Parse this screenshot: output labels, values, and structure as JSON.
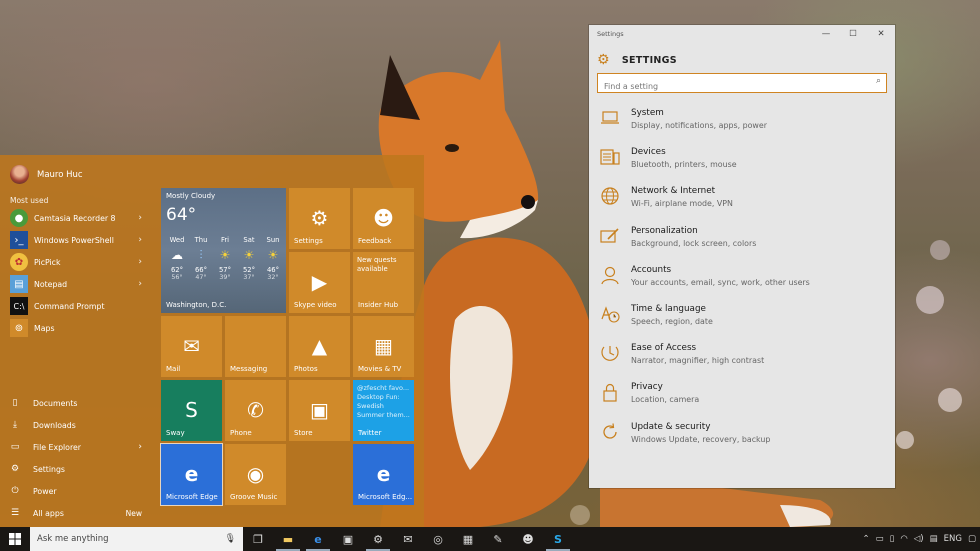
{
  "settings_window": {
    "window_title": "Settings",
    "header": "SETTINGS",
    "search_placeholder": "Find a setting",
    "categories": [
      {
        "name": "System",
        "desc": "Display, notifications, apps, power",
        "icon": "laptop-icon"
      },
      {
        "name": "Devices",
        "desc": "Bluetooth, printers, mouse",
        "icon": "keyboard-icon"
      },
      {
        "name": "Network & Internet",
        "desc": "Wi-Fi, airplane mode, VPN",
        "icon": "globe-icon"
      },
      {
        "name": "Personalization",
        "desc": "Background, lock screen, colors",
        "icon": "paint-icon"
      },
      {
        "name": "Accounts",
        "desc": "Your accounts, email, sync, work, other users",
        "icon": "person-icon"
      },
      {
        "name": "Time & language",
        "desc": "Speech, region, date",
        "icon": "clock-language-icon"
      },
      {
        "name": "Ease of Access",
        "desc": "Narrator, magnifier, high contrast",
        "icon": "ease-access-icon"
      },
      {
        "name": "Privacy",
        "desc": "Location, camera",
        "icon": "lock-icon"
      },
      {
        "name": "Update & security",
        "desc": "Windows Update, recovery, backup",
        "icon": "refresh-icon"
      }
    ]
  },
  "start_menu": {
    "user_name": "Mauro Huc",
    "most_used_label": "Most used",
    "most_used": [
      {
        "label": "Camtasia Recorder 8",
        "has_arrow": true,
        "icon": "camtasia-icon"
      },
      {
        "label": "Windows PowerShell",
        "has_arrow": true,
        "icon": "powershell-icon"
      },
      {
        "label": "PicPick",
        "has_arrow": true,
        "icon": "picpick-icon"
      },
      {
        "label": "Notepad",
        "has_arrow": true,
        "icon": "notepad-icon"
      },
      {
        "label": "Command Prompt",
        "has_arrow": false,
        "icon": "command-prompt-icon"
      },
      {
        "label": "Maps",
        "has_arrow": false,
        "icon": "maps-icon"
      }
    ],
    "system_items": [
      {
        "label": "Documents",
        "icon": "documents-icon"
      },
      {
        "label": "Downloads",
        "icon": "downloads-icon"
      },
      {
        "label": "File Explorer",
        "icon": "folder-icon",
        "has_arrow": true
      },
      {
        "label": "Settings",
        "icon": "gear-icon"
      },
      {
        "label": "Power",
        "icon": "power-icon"
      },
      {
        "label": "All apps",
        "icon": "all-apps-icon",
        "badge": "New"
      }
    ],
    "weather": {
      "condition": "Mostly Cloudy",
      "temp": "64°",
      "city": "Washington, D.C.",
      "days": [
        {
          "day": "Wed",
          "hi": "62°",
          "lo": "56°",
          "icon": "cloud-icon"
        },
        {
          "day": "Thu",
          "hi": "66°",
          "lo": "47°",
          "icon": "rain-icon"
        },
        {
          "day": "Fri",
          "hi": "57°",
          "lo": "39°",
          "icon": "sun-icon"
        },
        {
          "day": "Sat",
          "hi": "52°",
          "lo": "37°",
          "icon": "sun-icon"
        },
        {
          "day": "Sun",
          "hi": "46°",
          "lo": "32°",
          "icon": "sun-icon"
        }
      ]
    },
    "tiles": {
      "settings": "Settings",
      "feedback": "Feedback",
      "skype_video": "Skype video",
      "insider_hub": "Insider Hub",
      "insider_text": "New quests available",
      "mail": "Mail",
      "messaging": "Messaging",
      "photos": "Photos",
      "movies_tv": "Movies & TV",
      "sway": "Sway",
      "phone": "Phone",
      "store": "Store",
      "twitter": "Twitter",
      "twitter_text": "@zfescht favo... Desktop Fun: Swedish Summer them...",
      "edge": "Microsoft Edge",
      "groove": "Groove Music",
      "edge2": "Microsoft Edg..."
    }
  },
  "taskbar": {
    "search_placeholder": "Ask me anything",
    "language": "ENG"
  },
  "colors": {
    "accent": "#c8801e",
    "start_bg": "#be761c",
    "tile_orange": "#d08a2a"
  }
}
